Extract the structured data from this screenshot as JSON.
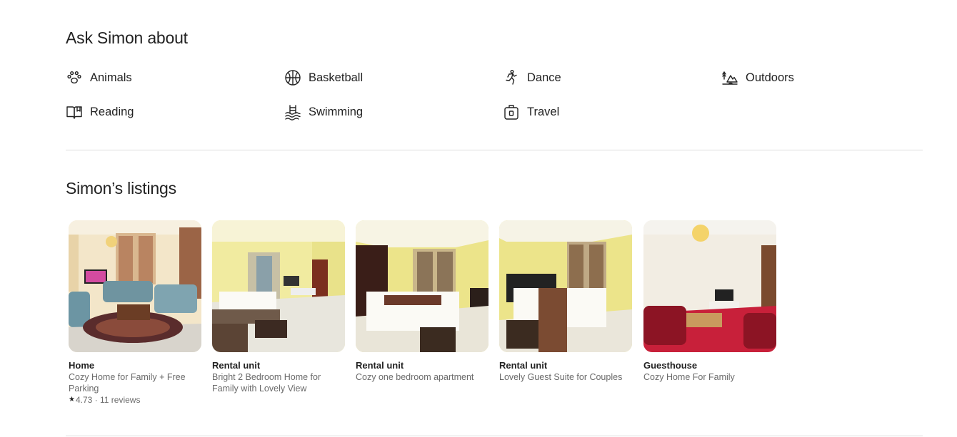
{
  "ask_section": {
    "title": "Ask Simon about",
    "interests": [
      {
        "label": "Animals",
        "icon": "paw-icon"
      },
      {
        "label": "Basketball",
        "icon": "basketball-icon"
      },
      {
        "label": "Dance",
        "icon": "dance-icon"
      },
      {
        "label": "Outdoors",
        "icon": "outdoors-icon"
      },
      {
        "label": "Reading",
        "icon": "book-icon"
      },
      {
        "label": "Swimming",
        "icon": "swimming-icon"
      },
      {
        "label": "Travel",
        "icon": "suitcase-icon"
      }
    ]
  },
  "listings_section": {
    "title": "Simon’s listings",
    "listings": [
      {
        "type": "Home",
        "title": "Cozy Home for Family + Free Parking",
        "rating": "4.73",
        "reviews": "11 reviews",
        "rating_text": "4.73 · 11 reviews"
      },
      {
        "type": "Rental unit",
        "title": "Bright 2 Bedroom Home for Family with Lovely View"
      },
      {
        "type": "Rental unit",
        "title": "Cozy one bedroom apartment"
      },
      {
        "type": "Rental unit",
        "title": "Lovely Guest Suite for Couples"
      },
      {
        "type": "Guesthouse",
        "title": "Cozy Home For Family"
      }
    ]
  },
  "colors": {
    "text": "#222222",
    "muted": "#6a6a6a",
    "divider": "#dddddd"
  }
}
